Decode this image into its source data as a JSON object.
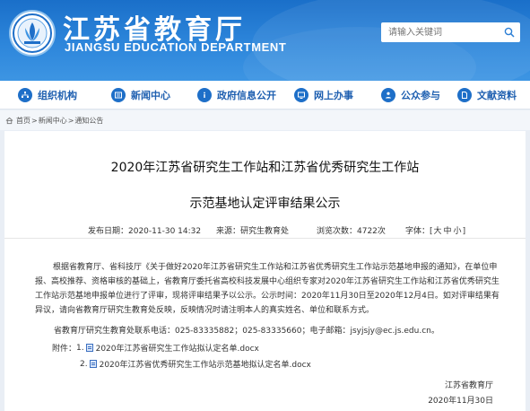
{
  "header": {
    "title": "江苏省教育厅",
    "subtitle": "JIANGSU EDUCATION DEPARTMENT",
    "search_placeholder": "请输入关键词"
  },
  "nav": {
    "items": [
      {
        "label": "组织机构",
        "icon": "org-icon"
      },
      {
        "label": "新闻中心",
        "icon": "news-icon"
      },
      {
        "label": "政府信息公开",
        "icon": "info-icon"
      },
      {
        "label": "网上办事",
        "icon": "service-icon"
      },
      {
        "label": "公众参与",
        "icon": "people-icon"
      },
      {
        "label": "文献资料",
        "icon": "doc-icon"
      }
    ]
  },
  "breadcrumb": {
    "home": "首页",
    "sep": ">",
    "news": "新闻中心",
    "current": "通知公告"
  },
  "article": {
    "title_line1": "2020年江苏省研究生工作站和江苏省优秀研究生工作站",
    "title_line2": "示范基地认定评审结果公示",
    "published": "发布日期：2020-11-30 14:32",
    "source": "来源：研究生教育处",
    "views": "浏览次数：4722次",
    "fontsize_label": "字体：[",
    "fontsize_large": "大",
    "fontsize_medium": "中",
    "fontsize_small": "小",
    "fontsize_end": "]",
    "body": "根据省教育厅、省科技厅《关于做好2020年江苏省研究生工作站和江苏省优秀研究生工作站示范基地申报的通知》，在单位申报、高校推荐、资格审核的基础上，省教育厅委托省高校科技发展中心组织专家对2020年江苏省研究生工作站和江苏省优秀研究生工作站示范基地申报单位进行了评审，现将评审结果予以公示。公示时间：2020年11月30日至2020年12月4日。如对评审结果有异议，请向省教育厅研究生教育处反映，反映情况时请注明本人的真实姓名、单位和联系方式。",
    "contact": "省教育厅研究生教育处联系电话：025-83335882；025-83335660；电子邮箱：jsyjsjy@ec.js.edu.cn。",
    "attachments_label": "附件：",
    "attachments": [
      {
        "num": "1.",
        "name": "2020年江苏省研究生工作站拟认定名单.docx"
      },
      {
        "num": "2.",
        "name": "2020年江苏省优秀研究生工作站示范基地拟认定名单.docx"
      }
    ],
    "signature": "江苏省教育厅",
    "date": "2020年11月30日"
  }
}
